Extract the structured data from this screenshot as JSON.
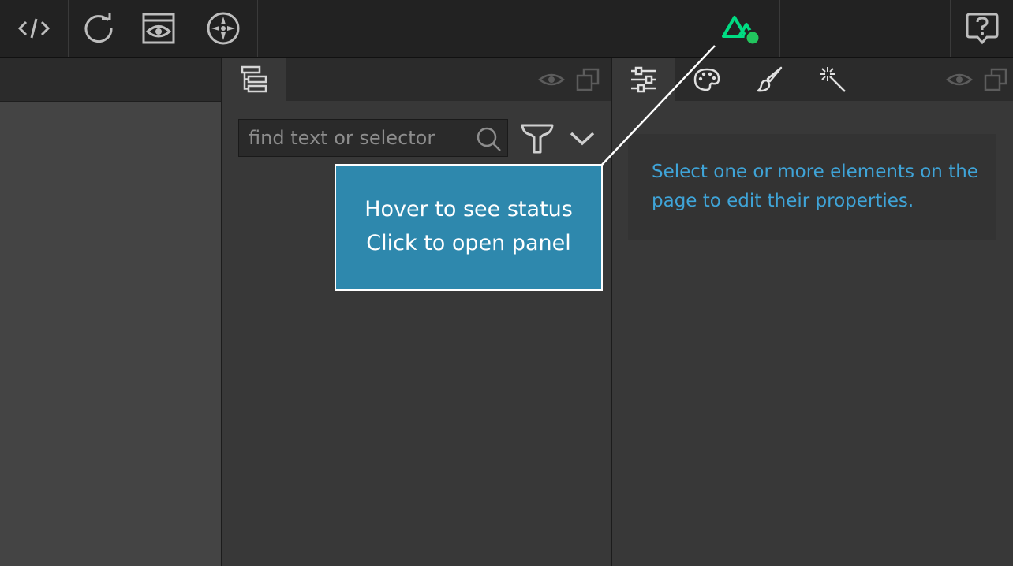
{
  "toolbar": {
    "buttons": [
      {
        "name": "code",
        "icon": "code-icon"
      },
      {
        "name": "reload",
        "icon": "reload-icon"
      },
      {
        "name": "preview",
        "icon": "preview-eye-icon"
      },
      {
        "name": "assets",
        "icon": "compass-icon"
      },
      {
        "name": "nuxt-status",
        "icon": "nuxt-logo-icon",
        "status_color": "#22c55e"
      },
      {
        "name": "help",
        "icon": "help-icon"
      }
    ]
  },
  "navigator": {
    "tab_icon": "layer-tree-icon",
    "search": {
      "placeholder": "find text or selector",
      "value": ""
    }
  },
  "properties": {
    "tabs": [
      {
        "name": "settings",
        "icon": "sliders-icon"
      },
      {
        "name": "style",
        "icon": "palette-icon"
      },
      {
        "name": "paint",
        "icon": "brush-icon"
      },
      {
        "name": "effects",
        "icon": "magic-wand-icon"
      }
    ],
    "empty_message": "Select one or more elements on the page to edit their properties."
  },
  "callout": {
    "line1": "Hover to see status",
    "line2": "Click to open panel"
  },
  "colors": {
    "accent_blue": "#3fa4d8",
    "callout_bg": "#2e88ad",
    "nuxt_green": "#00dc82",
    "status_green": "#22c55e"
  }
}
